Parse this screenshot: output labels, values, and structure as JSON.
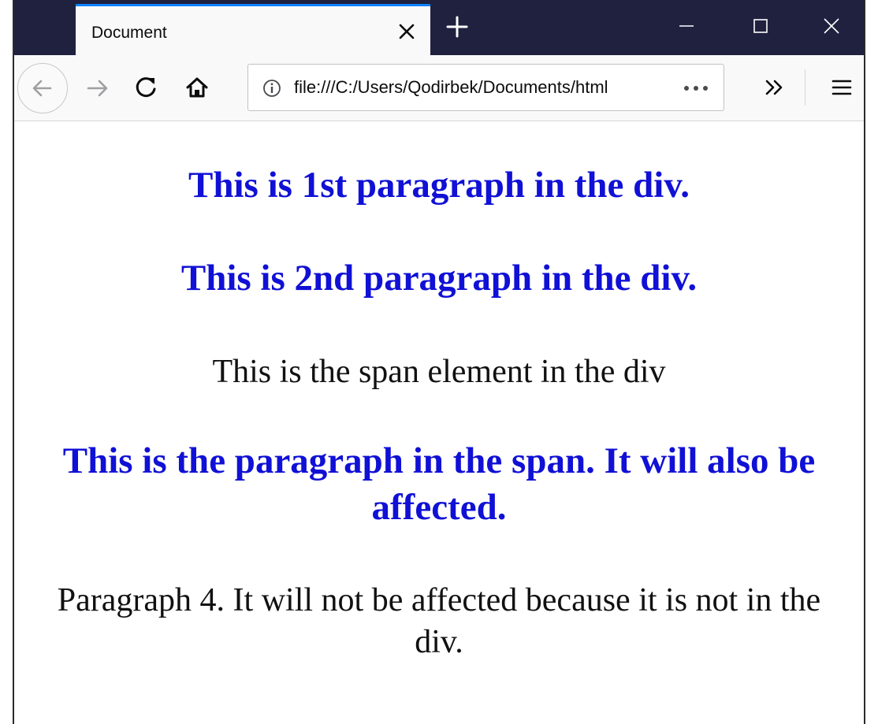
{
  "browser": {
    "tab_title": "Document",
    "url": "file:///C:/Users/Qodirbek/Documents/html",
    "url_more": "•••"
  },
  "page": {
    "p1": "This is 1st paragraph in the div.",
    "p2": "This is 2nd paragraph in the div.",
    "span_text": "This is the span element in the div",
    "p3": "This is the paragraph in the span. It will also be affected.",
    "p4": "Paragraph 4. It will not be affected because it is not in the div."
  },
  "colors": {
    "titlebar": "#1f213f",
    "tab_accent": "#0a84ff",
    "highlight_text": "#1010d6"
  },
  "icons": {
    "back": "back-arrow-icon",
    "forward": "forward-arrow-icon",
    "reload": "reload-icon",
    "home": "home-icon",
    "info": "info-icon",
    "overflow": "chevron-double-right-icon",
    "menu": "hamburger-menu-icon"
  }
}
